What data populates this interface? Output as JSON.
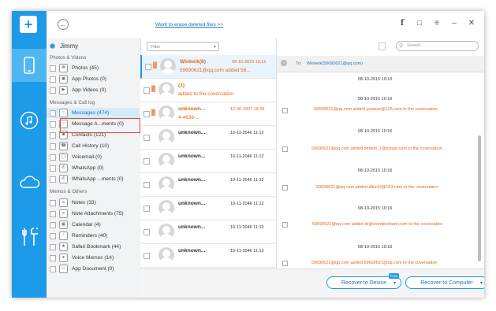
{
  "topbar": {
    "back_icon": "arrow-left",
    "erase_link": "Want to erase deleted files >>",
    "icons": [
      "facebook-icon",
      "feedback-icon",
      "menu-icon",
      "minimize-icon",
      "close-icon"
    ]
  },
  "sidebar": {
    "device": "Jimmy",
    "sections": [
      {
        "title": "Photos & Videos",
        "items": [
          {
            "label": "Photos (45)"
          },
          {
            "label": "App Photos (0)"
          },
          {
            "label": "App Videos (0)"
          }
        ]
      },
      {
        "title": "Messages & Call log",
        "items": [
          {
            "label": "Messages (474)"
          },
          {
            "label": "Message A...ments (0)"
          },
          {
            "label": "Contacts (121)"
          },
          {
            "label": "Call History (10)"
          },
          {
            "label": "Voicemail (0)"
          },
          {
            "label": "WhatsApp (0)"
          },
          {
            "label": "WhatsApp ...ments (0)"
          }
        ]
      },
      {
        "title": "Memos & Others",
        "items": [
          {
            "label": "Notes (33)"
          },
          {
            "label": "Note Attachments (75)"
          },
          {
            "label": "Calendar (4)"
          },
          {
            "label": "Reminders (40)"
          },
          {
            "label": "Safari Bookmark (44)"
          },
          {
            "label": "Voice Memos (14)"
          },
          {
            "label": "App Document (0)"
          }
        ]
      }
    ]
  },
  "list": {
    "filter_placeholder": "Filter",
    "messages": [
      {
        "name": "Winkeik(6)",
        "date": "08-10-2015 10:16",
        "preview": "59690621@qq.com added 59..."
      },
      {
        "name": "(1)",
        "date": "",
        "preview": "added  to the coversation"
      },
      {
        "name": "unknown...",
        "date": "12-06-2007 18:35",
        "preview": "4-4638-..."
      },
      {
        "name": "unknown...",
        "date": "10-11-2046 11:12",
        "preview": ""
      },
      {
        "name": "unknown...",
        "date": "10-11-2046 11:12",
        "preview": ""
      },
      {
        "name": "unknown...",
        "date": "10-11-2046 11:12",
        "preview": ""
      },
      {
        "name": "unknown...",
        "date": "10-11-2046 11:12",
        "preview": ""
      },
      {
        "name": "unknown...",
        "date": "10-11-2046 11:12",
        "preview": ""
      },
      {
        "name": "unknown...",
        "date": "10-11-2046 11:12",
        "preview": ""
      }
    ]
  },
  "detail": {
    "search_placeholder": "Search",
    "to_label": "To:",
    "to_value": "Winkeik(59690621@qq.com)",
    "entries": [
      {
        "date": "08-10-2015 10:16",
        "text": ""
      },
      {
        "date": "08-10-2015 10:16",
        "text": "59690621@qq.com added yuwexe@126.com to the coversation"
      },
      {
        "date": "08-10-2015 10:16",
        "text": "59690621@qq.com added dmtest_1@icloud.com to the coversation"
      },
      {
        "date": "08-10-2015 10:16",
        "text": "59690621@qq.com added allen1f@163.com to the coversation"
      },
      {
        "date": "08-10-2015 10:16",
        "text": "59690621@qq.com added dr@wondershare.com to the coversation"
      },
      {
        "date": "08-10-2015 10:16",
        "text": "59690621@qq.com added 59690621@qq.com to the coversation"
      }
    ]
  },
  "buttons": {
    "recover_device": "Recover to Device",
    "free_badge": "Free",
    "recover_computer": "Recover to Computer"
  }
}
